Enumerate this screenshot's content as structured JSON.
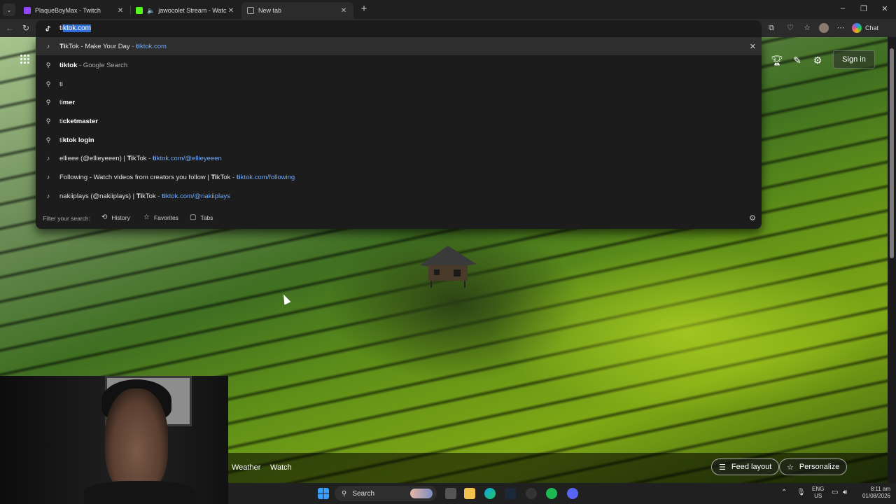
{
  "tabs": [
    {
      "title": "PlaqueBoyMax - Twitch",
      "close": "✕",
      "favicon_color": "#9146ff"
    },
    {
      "title": "jawocolet Stream - Watch Live",
      "close": "✕",
      "favicon_color": "#53fc18"
    },
    {
      "title": "New tab",
      "close": "✕",
      "favicon_color": "#aaaaaa"
    }
  ],
  "omnibox": {
    "typed": "ti",
    "completion": "ktok.com"
  },
  "toolbar": {
    "chat_label": "Chat"
  },
  "suggestions": [
    {
      "icon": "tiktok-icon",
      "bold": "Ti",
      "rest": "kTok - Make Your Day",
      "sep": " - ",
      "url_bold": "ti",
      "url_rest": "ktok.com",
      "selected": true
    },
    {
      "icon": "search-icon",
      "bold_prefix": "ti",
      "bold": "ktok",
      "suffix": " - Google Search"
    },
    {
      "icon": "search-icon",
      "text": "ti"
    },
    {
      "icon": "search-icon",
      "plain": "ti",
      "bold": "mer"
    },
    {
      "icon": "search-icon",
      "plain": "ti",
      "bold": "cketmaster"
    },
    {
      "icon": "search-icon",
      "plain": "ti",
      "bold": "ktok login"
    },
    {
      "icon": "tiktok-icon",
      "title": "ellieee (@ellieyeeen) | ",
      "title_bold": "Ti",
      "title_rest": "kTok",
      "sep": " - ",
      "url_bold": "ti",
      "url_rest": "ktok.com/@ellieyeeen"
    },
    {
      "icon": "tiktok-icon",
      "title": "Following - Watch videos from creators you follow | ",
      "title_bold": "Ti",
      "title_rest": "kTok",
      "sep": " - ",
      "url_bold": "ti",
      "url_rest": "ktok.com/following"
    },
    {
      "icon": "tiktok-icon",
      "title": "nakiiplays (@nakiiplays) | ",
      "title_bold": "Ti",
      "title_rest": "kTok",
      "sep": " - ",
      "url_bold": "ti",
      "url_rest": "ktok.com/@nakiiplays"
    }
  ],
  "filter": {
    "label": "Filter your search:",
    "history": "History",
    "favorites": "Favorites",
    "tabs": "Tabs"
  },
  "page": {
    "signin": "Sign in",
    "weather": "Weather",
    "watch": "Watch",
    "feed_layout": "Feed layout",
    "personalize": "Personalize"
  },
  "taskbar": {
    "search": "Search",
    "lang_top": "ENG",
    "lang_bottom": "US",
    "time": "8:11 am",
    "date": "01/08/2026"
  }
}
